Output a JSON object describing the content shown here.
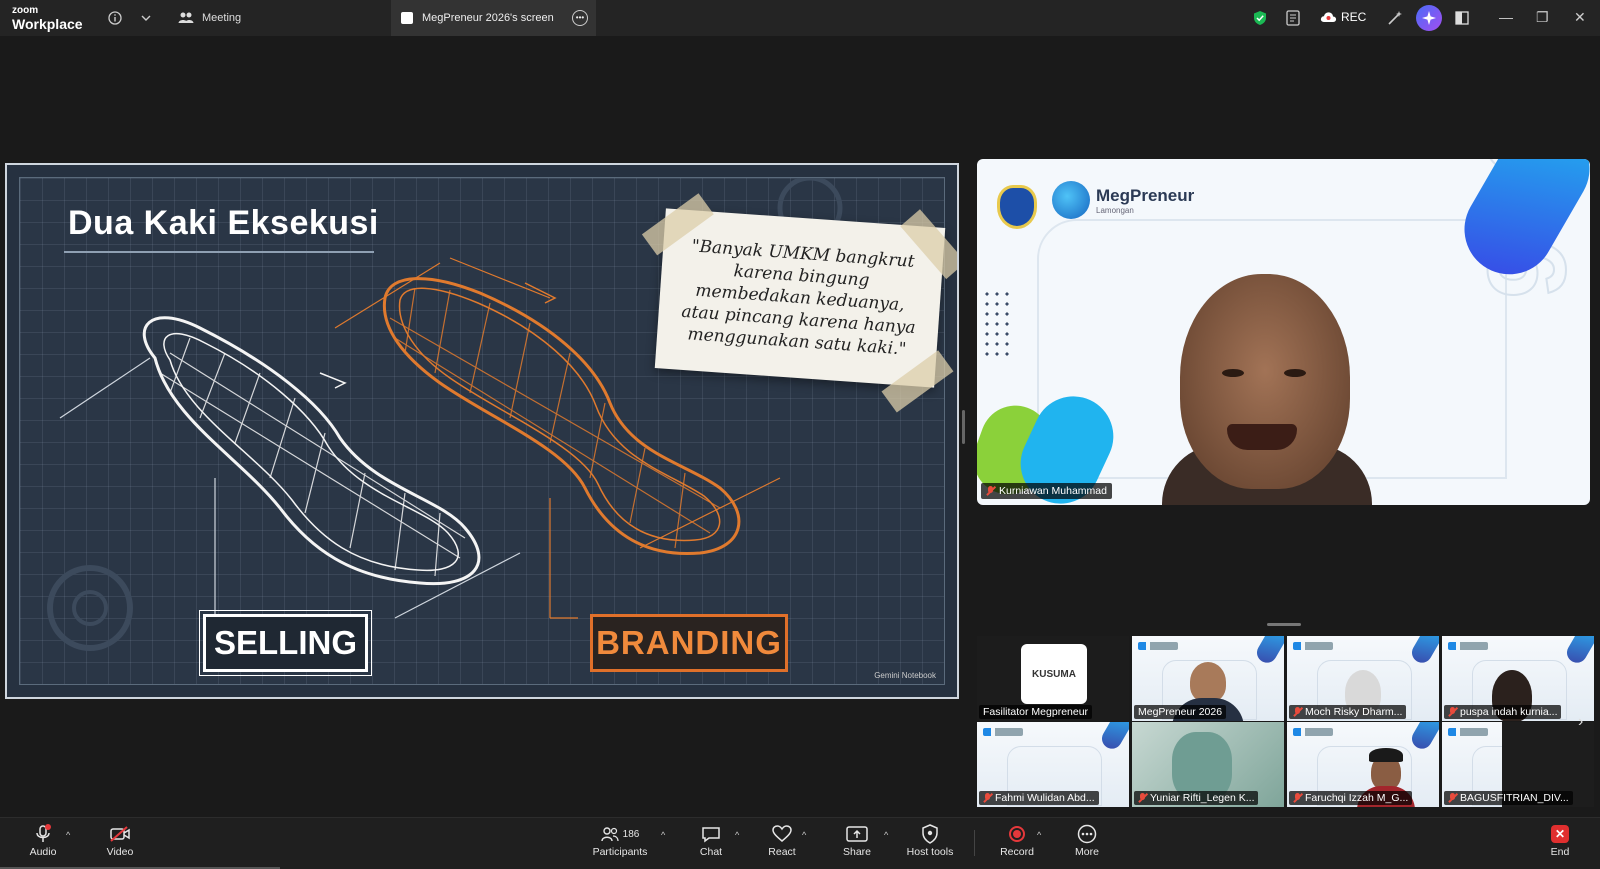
{
  "titlebar": {
    "logo_top": "zoom",
    "logo_bottom": "Workplace",
    "info_icon": "info-icon",
    "meeting_label": "Meeting",
    "screen_tab_label": "MegPreneur 2026's screen",
    "rec_label": "REC"
  },
  "slide": {
    "title": "Dua Kaki Eksekusi",
    "quote": "\"Banyak UMKM bangkrut karena bingung membedakan keduanya, atau pincang karena hanya menggunakan satu kaki.\"",
    "label_left": "SELLING",
    "label_right": "BRANDING",
    "watermark": "Gemini Notebook",
    "colors": {
      "left_shoe": "#ffffff",
      "right_shoe": "#e07a2e",
      "background": "#2a3646"
    }
  },
  "speaker": {
    "name": "Kurniawan Muhammad",
    "brand_name": "MegPreneur",
    "brand_sub": "Lamongan",
    "year": "2026",
    "muted": true
  },
  "gallery": [
    {
      "name": "Fasilitator Megpreneur",
      "muted": false,
      "kind": "logo",
      "logo_text": "KUSUMA"
    },
    {
      "name": "MegPreneur 2026",
      "muted": false,
      "kind": "person"
    },
    {
      "name": "Moch Risky Dharm...",
      "muted": true,
      "kind": "person"
    },
    {
      "name": "puspa indah kurnia...",
      "muted": true,
      "kind": "bg"
    },
    {
      "name": "Fahmi Wulidan Abd...",
      "muted": true,
      "kind": "bg"
    },
    {
      "name": "Yuniar Rifti_Legen K...",
      "muted": true,
      "kind": "person"
    },
    {
      "name": "Faruchqi Izzah M_G...",
      "muted": true,
      "kind": "person"
    },
    {
      "name": "BAGUSFITRIAN_DIV...",
      "muted": true,
      "kind": "dark"
    }
  ],
  "toolbar": {
    "audio": "Audio",
    "video": "Video",
    "participants": "Participants",
    "participants_count": "186",
    "chat": "Chat",
    "react": "React",
    "share": "Share",
    "host_tools": "Host tools",
    "record": "Record",
    "more": "More",
    "end": "End"
  }
}
